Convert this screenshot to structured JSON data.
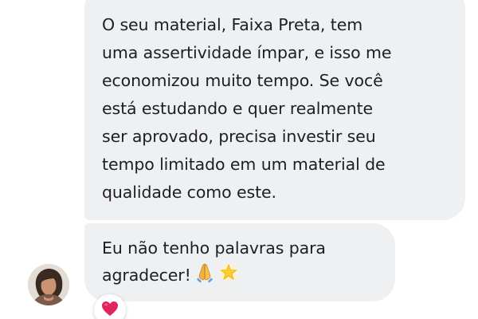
{
  "messages": [
    {
      "lines": [
        "O seu material, Faixa Preta, tem",
        "uma assertividade ímpar, e isso me",
        "economizou muito tempo. Se você",
        "está estudando e quer realmente",
        "ser aprovado, precisa investir seu",
        "tempo limitado em um material de",
        "qualidade como este."
      ]
    },
    {
      "lines": [
        "Eu não tenho palavras para",
        "agradecer!"
      ],
      "emojis": [
        "folded-hands-icon",
        "glowing-star-icon"
      ]
    }
  ],
  "reaction": {
    "icon": "red-heart-icon",
    "color": "#e0245e"
  },
  "colors": {
    "bubble": "#eff0f2",
    "text": "#1c1e21"
  }
}
